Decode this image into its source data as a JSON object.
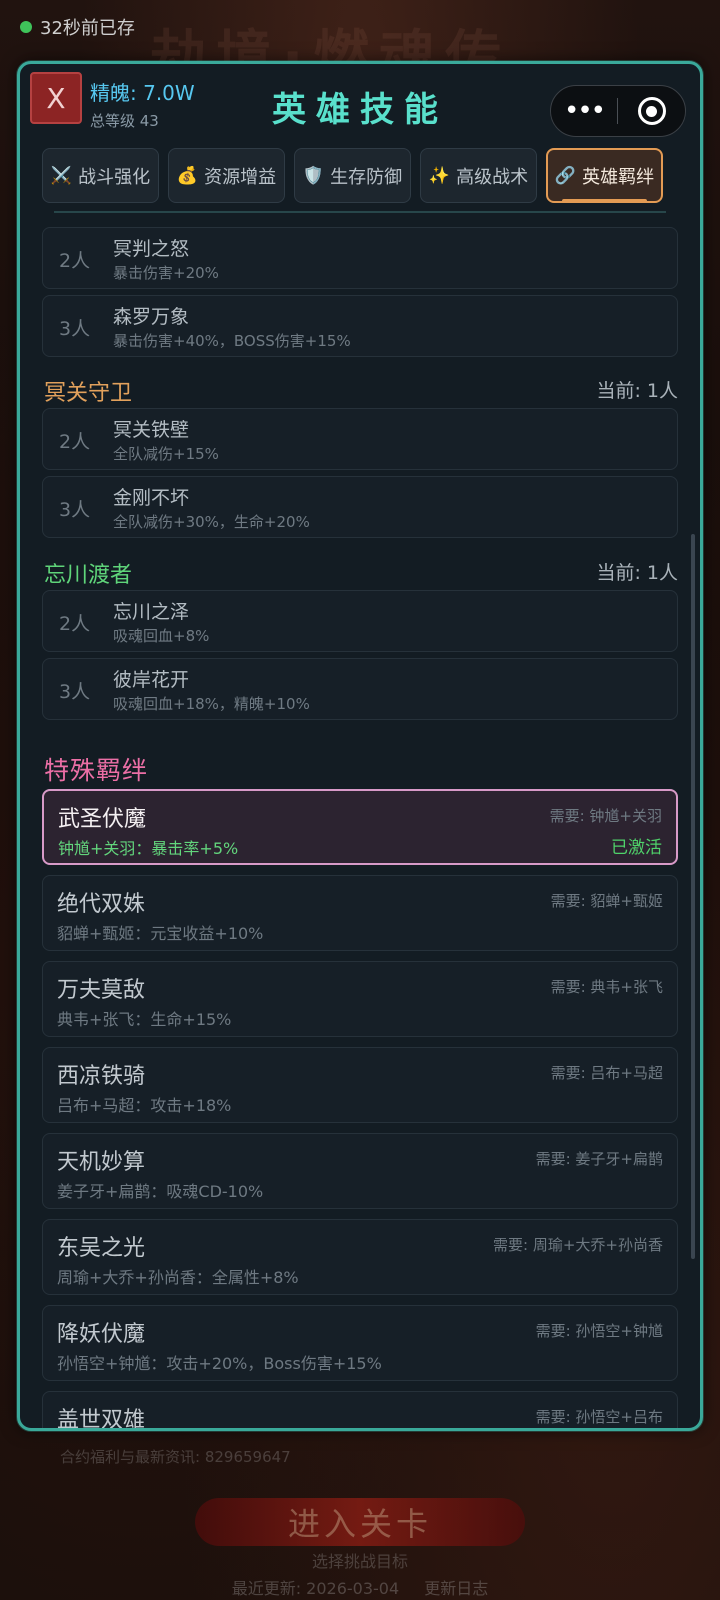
{
  "save_status": "32秒前已存",
  "background_title": "劫境·燃魂传",
  "modal": {
    "close_label": "X",
    "essence": "精魄: 7.0W",
    "total_level": "总等级 43",
    "title": "英雄技能",
    "capsule_more": "•••"
  },
  "tabs": [
    {
      "icon": "⚔️",
      "label": "战斗强化"
    },
    {
      "icon": "💰",
      "label": "资源增益"
    },
    {
      "icon": "🛡️",
      "label": "生存防御"
    },
    {
      "icon": "✨",
      "label": "高级战术"
    },
    {
      "icon": "🔗",
      "label": "英雄羁绊",
      "active": true
    }
  ],
  "groups": [
    {
      "title": "",
      "current": "",
      "color": "#e2a15c",
      "tiers": [
        {
          "count": "2人",
          "name": "冥判之怒",
          "effect": "暴击伤害+20%"
        },
        {
          "count": "3人",
          "name": "森罗万象",
          "effect": "暴击伤害+40%，BOSS伤害+15%"
        }
      ]
    },
    {
      "title": "冥关守卫",
      "current": "当前: 1人",
      "color": "#e2a15c",
      "tiers": [
        {
          "count": "2人",
          "name": "冥关铁壁",
          "effect": "全队减伤+15%"
        },
        {
          "count": "3人",
          "name": "金刚不坏",
          "effect": "全队减伤+30%，生命+20%"
        }
      ]
    },
    {
      "title": "忘川渡者",
      "current": "当前: 1人",
      "color": "#5fd57a",
      "tiers": [
        {
          "count": "2人",
          "name": "忘川之泽",
          "effect": "吸魂回血+8%"
        },
        {
          "count": "3人",
          "name": "彼岸花开",
          "effect": "吸魂回血+18%，精魄+10%"
        }
      ]
    }
  ],
  "special": {
    "title": "特殊羁绊",
    "bonds": [
      {
        "name": "武圣伏魔",
        "effect": "钟馗+关羽：暴击率+5%",
        "requirement": "需要: 钟馗+关羽",
        "status": "已激活",
        "active": true
      },
      {
        "name": "绝代双姝",
        "effect": "貂蝉+甄姬：元宝收益+10%",
        "requirement": "需要: 貂蝉+甄姬"
      },
      {
        "name": "万夫莫敌",
        "effect": "典韦+张飞：生命+15%",
        "requirement": "需要: 典韦+张飞"
      },
      {
        "name": "西凉铁骑",
        "effect": "吕布+马超：攻击+18%",
        "requirement": "需要: 吕布+马超"
      },
      {
        "name": "天机妙算",
        "effect": "姜子牙+扁鹊：吸魂CD-10%",
        "requirement": "需要: 姜子牙+扁鹊"
      },
      {
        "name": "东吴之光",
        "effect": "周瑜+大乔+孙尚香：全属性+8%",
        "requirement": "需要: 周瑜+大乔+孙尚香"
      },
      {
        "name": "降妖伏魔",
        "effect": "孙悟空+钟馗：攻击+20%，Boss伤害+15%",
        "requirement": "需要: 孙悟空+钟馗"
      },
      {
        "name": "盖世双雄",
        "effect": "",
        "requirement": "需要: 孙悟空+吕布"
      }
    ]
  },
  "background_bottom": {
    "contact_line": "合约福利与最新资讯: 829659647",
    "enter_button": "进入关卡",
    "enter_subtitle": "选择挑战目标",
    "last_update": "最近更新: 2026-03-04",
    "changelog": "更新日志"
  }
}
